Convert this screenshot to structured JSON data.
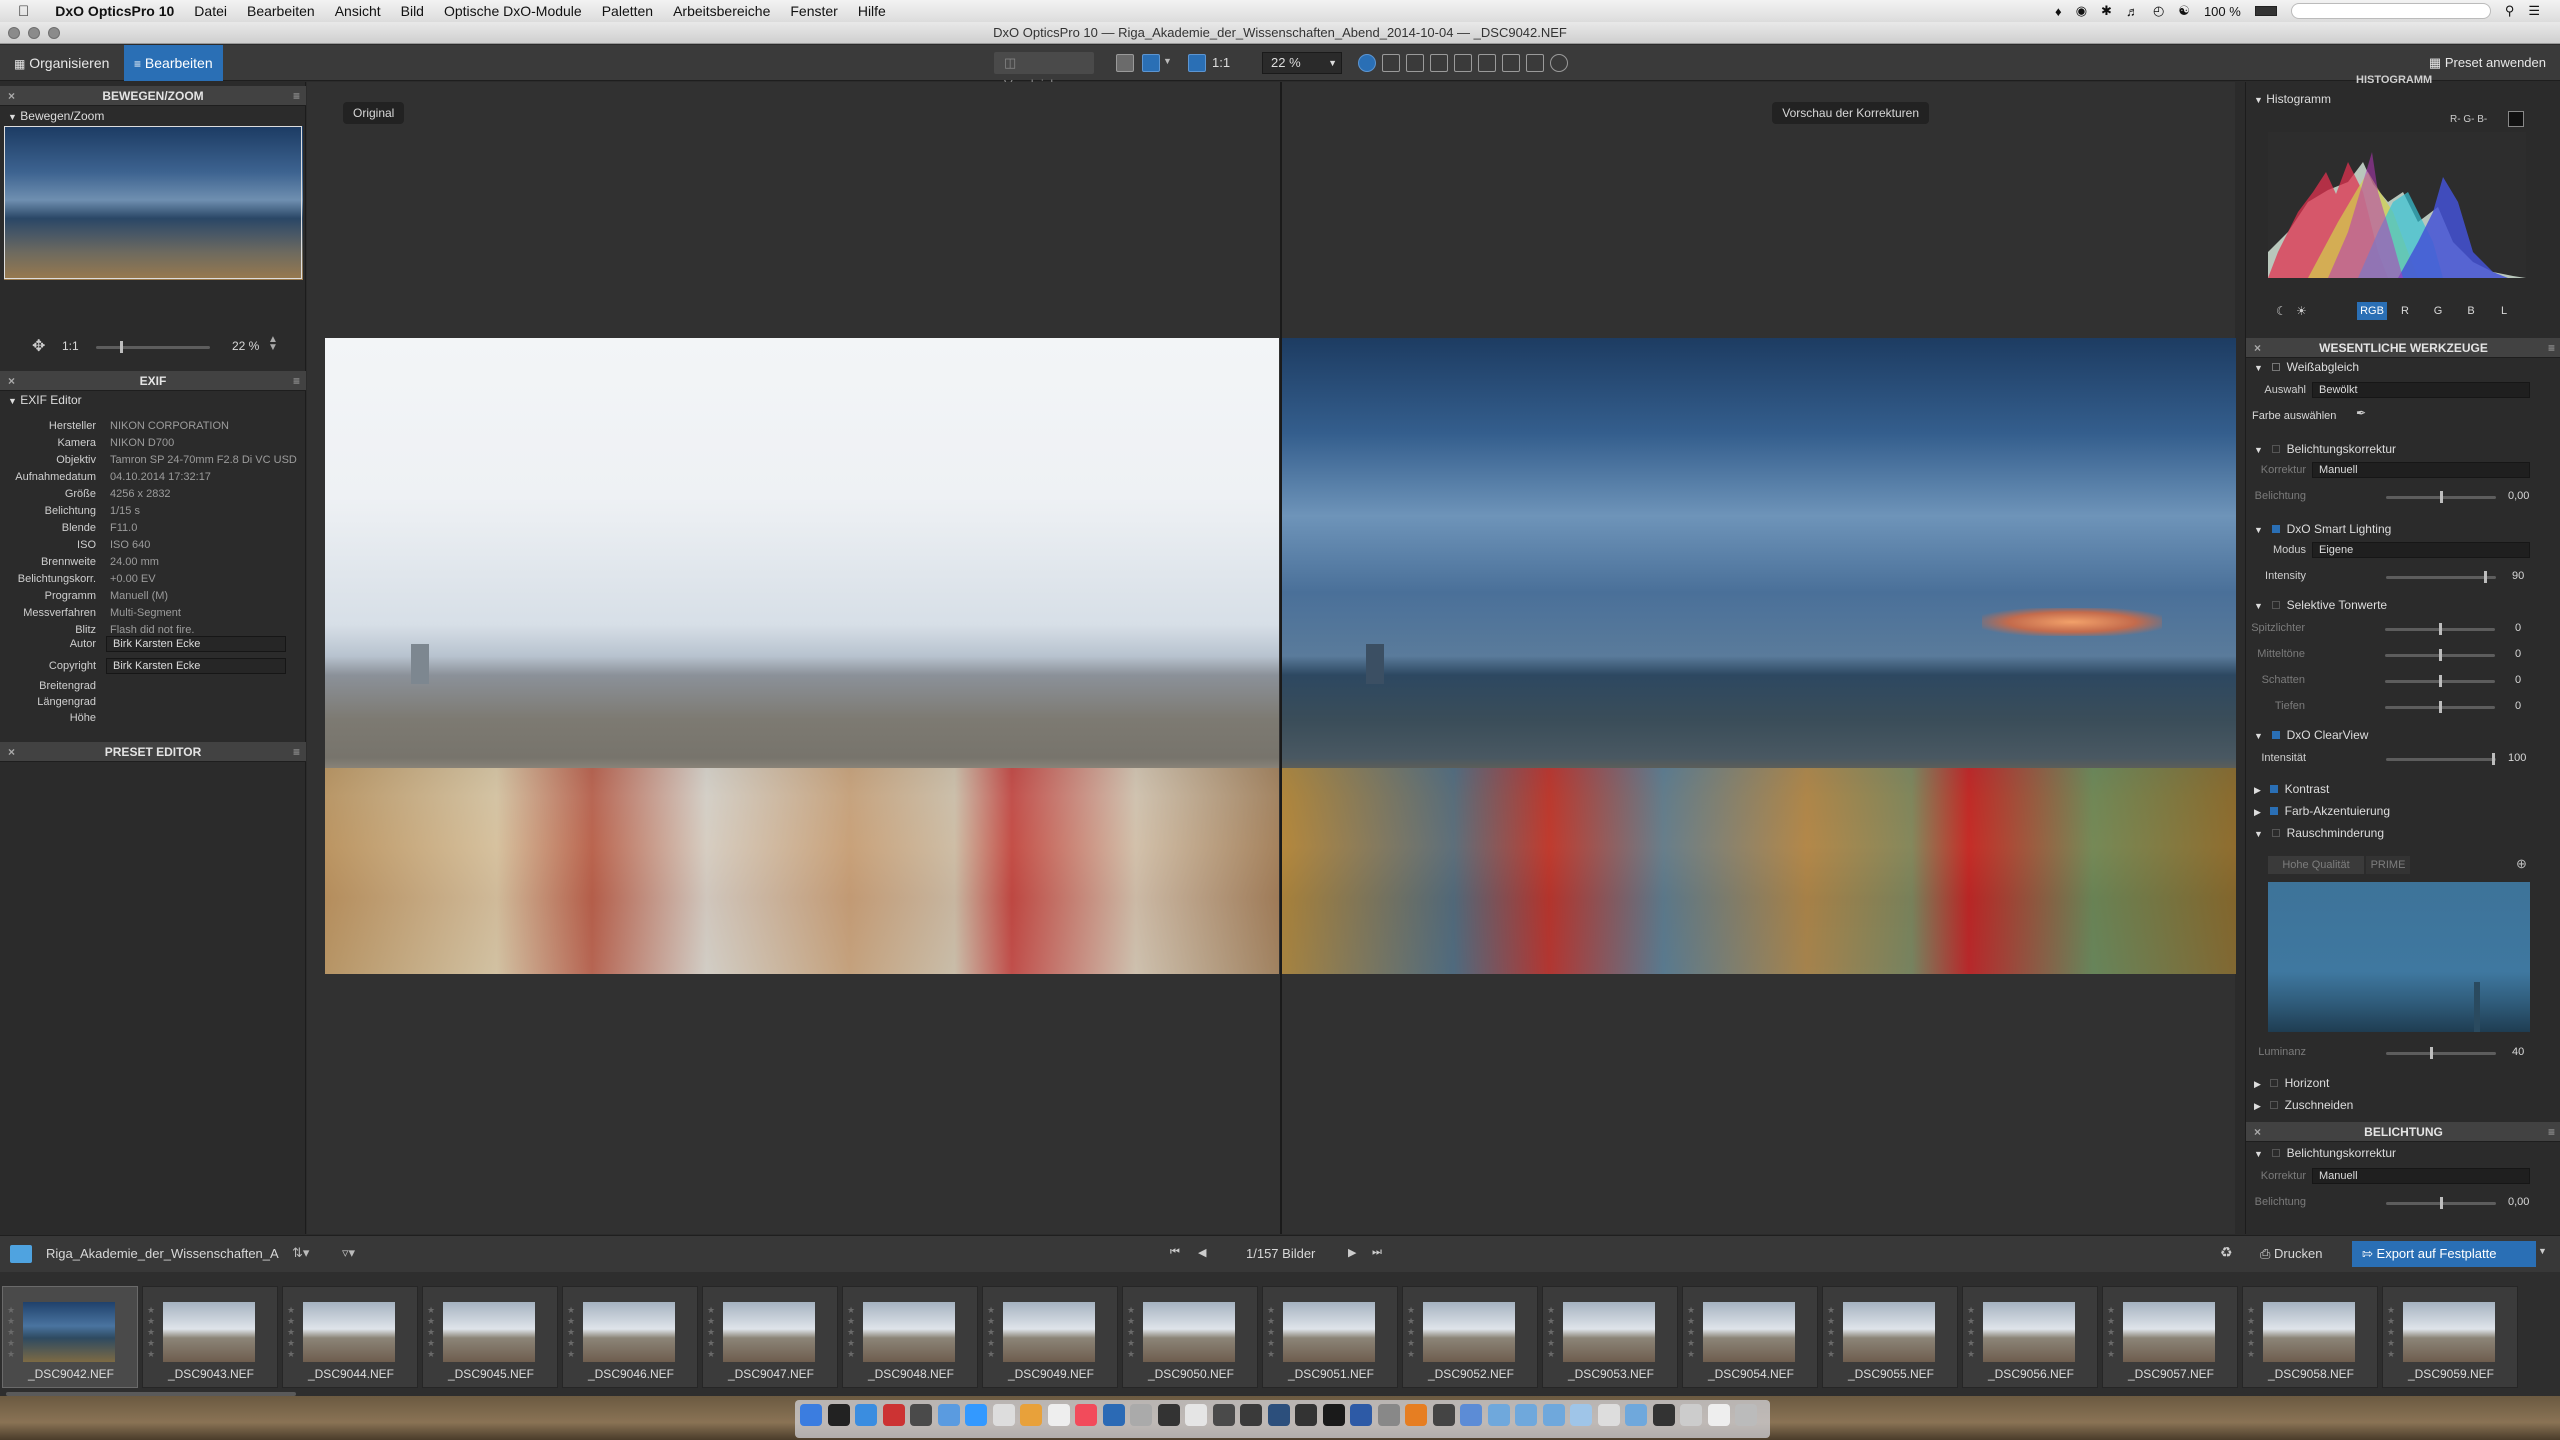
{
  "menubar": {
    "app": "DxO OpticsPro 10",
    "items": [
      "Datei",
      "Bearbeiten",
      "Ansicht",
      "Bild",
      "Optische DxO-Module",
      "Paletten",
      "Arbeitsbereiche",
      "Fenster",
      "Hilfe"
    ],
    "battery": "100 %"
  },
  "window": {
    "title": "DxO OpticsPro 10 — Riga_Akademie_der_Wissenschaften_Abend_2014-10-04 — _DSC9042.NEF"
  },
  "toolbar": {
    "organize": "Organisieren",
    "edit": "Bearbeiten",
    "compare": "Vergleichen",
    "one_to_one": "1:1",
    "zoom": "22 %",
    "apply_preset": "Preset anwenden"
  },
  "left": {
    "move_zoom_title": "BEWEGEN/ZOOM",
    "move_zoom_sub": "Bewegen/Zoom",
    "nav_ratio": "1:1",
    "nav_zoom": "22 %",
    "exif_title": "EXIF",
    "exif_editor": "EXIF Editor",
    "exif": [
      {
        "label": "Hersteller",
        "value": "NIKON CORPORATION"
      },
      {
        "label": "Kamera",
        "value": "NIKON D700"
      },
      {
        "label": "Objektiv",
        "value": "Tamron SP 24-70mm F2.8 Di VC USD"
      },
      {
        "label": "Aufnahmedatum",
        "value": "04.10.2014 17:32:17"
      },
      {
        "label": "Größe",
        "value": "4256 x 2832"
      },
      {
        "label": "Belichtung",
        "value": "1/15 s"
      },
      {
        "label": "Blende",
        "value": "F11.0"
      },
      {
        "label": "ISO",
        "value": "ISO 640"
      },
      {
        "label": "Brennweite",
        "value": "24.00 mm"
      },
      {
        "label": "Belichtungskorr.",
        "value": "+0.00 EV"
      },
      {
        "label": "Programm",
        "value": "Manuell (M)"
      },
      {
        "label": "Messverfahren",
        "value": "Multi-Segment"
      },
      {
        "label": "Blitz",
        "value": "Flash did not fire."
      }
    ],
    "author_label": "Autor",
    "author": "Birk Karsten Ecke",
    "copyright_label": "Copyright",
    "copyright": "Birk Karsten Ecke",
    "lat_label": "Breitengrad",
    "lon_label": "Längengrad",
    "alt_label": "Höhe",
    "preset_editor_title": "PRESET EDITOR"
  },
  "viewer": {
    "original_label": "Original",
    "preview_label": "Vorschau der Korrekturen"
  },
  "right": {
    "histogram_header": "HISTOGRAMM",
    "histogram_sub": "Histogramm",
    "rgb_readout": "R- G- B-",
    "channels": [
      "RGB",
      "R",
      "G",
      "B",
      "L"
    ],
    "essential_title": "WESENTLICHE WERKZEUGE",
    "wb": {
      "title": "Weißabgleich",
      "sel_label": "Auswahl",
      "sel_value": "Bewölkt",
      "pick": "Farbe auswählen"
    },
    "exposure": {
      "title": "Belichtungskorrektur",
      "corr_label": "Korrektur",
      "corr_value": "Manuell",
      "exp_label": "Belichtung",
      "exp_value": "0,00"
    },
    "smart": {
      "title": "DxO Smart Lighting",
      "mode_label": "Modus",
      "mode_value": "Eigene",
      "int_label": "Intensity",
      "int_value": "90"
    },
    "tones": {
      "title": "Selektive Tonwerte",
      "rows": [
        {
          "label": "Spitzlichter",
          "value": "0"
        },
        {
          "label": "Mitteltöne",
          "value": "0"
        },
        {
          "label": "Schatten",
          "value": "0"
        },
        {
          "label": "Tiefen",
          "value": "0"
        }
      ]
    },
    "clearview": {
      "title": "DxO ClearView",
      "int_label": "Intensität",
      "int_value": "100"
    },
    "contrast": "Kontrast",
    "color_accent": "Farb-Akzentuierung",
    "noise": {
      "title": "Rauschminderung",
      "hq": "Hohe Qualität",
      "prime": "PRIME",
      "lum_label": "Luminanz",
      "lum_value": "40"
    },
    "horizon": "Horizont",
    "crop": "Zuschneiden",
    "exposure_panel_title": "BELICHTUNG",
    "exposure2": {
      "title": "Belichtungskorrektur",
      "corr_label": "Korrektur",
      "corr_value": "Manuell",
      "exp_label": "Belichtung",
      "exp_value": "0,00"
    }
  },
  "filmbar": {
    "folder": "Riga_Akademie_der_Wissenschaften_A",
    "counter": "1/157 Bilder",
    "print": "Drucken",
    "export": "Export auf Festplatte"
  },
  "thumbnails": [
    "_DSC9042.NEF",
    "_DSC9043.NEF",
    "_DSC9044.NEF",
    "_DSC9045.NEF",
    "_DSC9046.NEF",
    "_DSC9047.NEF",
    "_DSC9048.NEF",
    "_DSC9049.NEF",
    "_DSC9050.NEF",
    "_DSC9051.NEF",
    "_DSC9052.NEF",
    "_DSC9053.NEF",
    "_DSC9054.NEF",
    "_DSC9055.NEF",
    "_DSC9056.NEF",
    "_DSC9057.NEF",
    "_DSC9058.NEF",
    "_DSC9059.NEF"
  ],
  "colors": {
    "accent": "#2a6fb5",
    "panel": "#2b2b2b",
    "header": "#424242"
  }
}
